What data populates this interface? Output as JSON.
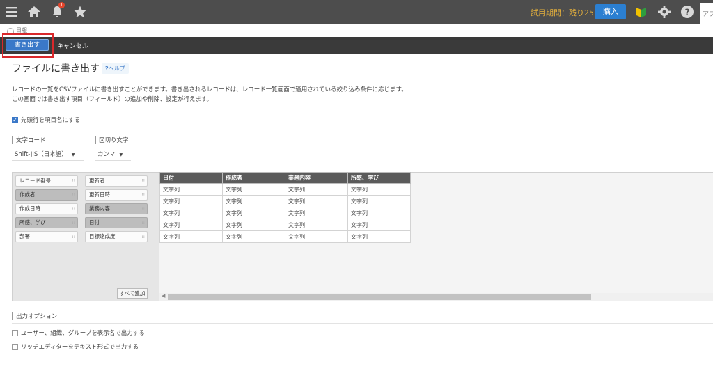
{
  "header": {
    "notification_count": "1",
    "trial_text": "試用期間：残り25日",
    "buy_label": "購入",
    "app_tab_label": "アプ",
    "icons": [
      "menu-icon",
      "home-icon",
      "bell-icon",
      "star-icon",
      "beginner-icon",
      "gear-icon",
      "help-icon"
    ]
  },
  "breadcrumb": {
    "label": "日報"
  },
  "toolbar": {
    "export_label": "書き出す",
    "cancel_label": "キャンセル"
  },
  "page": {
    "title": "ファイルに書き出す",
    "help_label": "ヘルプ",
    "description_line1": "レコードの一覧をCSVファイルに書き出すことができます。書き出されるレコードは、レコード一覧画面で適用されている絞り込み条件に応じます。",
    "description_line2": "この画面では書き出す項目（フィールド）の追加や削除、設定が行えます。",
    "header_row_checkbox": {
      "label": "先頭行を項目名にする",
      "checked": true
    }
  },
  "encoding": {
    "label": "文字コード",
    "value": "Shift-JIS（日本語）"
  },
  "delimiter": {
    "label": "区切り文字",
    "value": "カンマ"
  },
  "fields": {
    "left": [
      {
        "label": "レコード番号",
        "used": false
      },
      {
        "label": "作成者",
        "used": true
      },
      {
        "label": "作成日時",
        "used": false
      },
      {
        "label": "所感、学び",
        "used": true
      },
      {
        "label": "部署",
        "used": false
      }
    ],
    "right": [
      {
        "label": "更新者",
        "used": false
      },
      {
        "label": "更新日時",
        "used": false
      },
      {
        "label": "業務内容",
        "used": true
      },
      {
        "label": "日付",
        "used": true
      },
      {
        "label": "目標達成度",
        "used": false
      }
    ],
    "add_all_label": "すべて追加"
  },
  "preview": {
    "columns": [
      "日付",
      "作成者",
      "業務内容",
      "所感、学び"
    ],
    "cell_text": "文字列",
    "row_count": 5
  },
  "options": {
    "label": "出力オプション",
    "items": [
      {
        "label": "ユーザー、組織、グループを表示名で出力する",
        "checked": false
      },
      {
        "label": "リッチエディターをテキスト形式で出力する",
        "checked": false
      }
    ]
  },
  "colors": {
    "header_bg": "#4d4d4d",
    "accent": "#3a78c8",
    "trial": "#e8b23c",
    "highlight": "#d9282b"
  }
}
